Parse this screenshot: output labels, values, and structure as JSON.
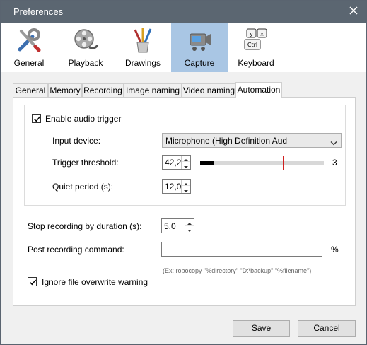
{
  "window": {
    "title": "Preferences"
  },
  "toolbar": {
    "items": [
      {
        "label": "General",
        "icon": "tools-icon"
      },
      {
        "label": "Playback",
        "icon": "film-reel-icon"
      },
      {
        "label": "Drawings",
        "icon": "brushes-icon"
      },
      {
        "label": "Capture",
        "icon": "camcorder-icon",
        "active": true
      },
      {
        "label": "Keyboard",
        "icon": "keyboard-icon"
      }
    ],
    "keyboard_keys": [
      "y",
      "x",
      "Ctrl"
    ]
  },
  "tabs": [
    "General",
    "Memory",
    "Recording",
    "Image naming",
    "Video naming",
    "Automation"
  ],
  "active_tab": "Automation",
  "audio_trigger": {
    "enable_label": "Enable audio trigger",
    "enabled": true,
    "input_device_label": "Input device:",
    "input_device_value": "Microphone (High Definition Aud",
    "threshold_label": "Trigger threshold:",
    "threshold_value": "42,2",
    "threshold_level_percent": 67,
    "threshold_display": "3",
    "quiet_label": "Quiet period (s):",
    "quiet_value": "12,0"
  },
  "stop_recording": {
    "label": "Stop recording by duration (s):",
    "value": "5,0"
  },
  "post_command": {
    "label": "Post recording command:",
    "value": "",
    "unit": "%",
    "hint": "(Ex: robocopy \"%directory\" \"D:\\backup\" \"%filename\")"
  },
  "overwrite": {
    "label": "Ignore file overwrite warning",
    "checked": true
  },
  "buttons": {
    "save": "Save",
    "cancel": "Cancel"
  },
  "colors": {
    "titlebar": "#5b6671",
    "active_tool": "#a9c6e4",
    "threshold_marker": "#d02020"
  }
}
